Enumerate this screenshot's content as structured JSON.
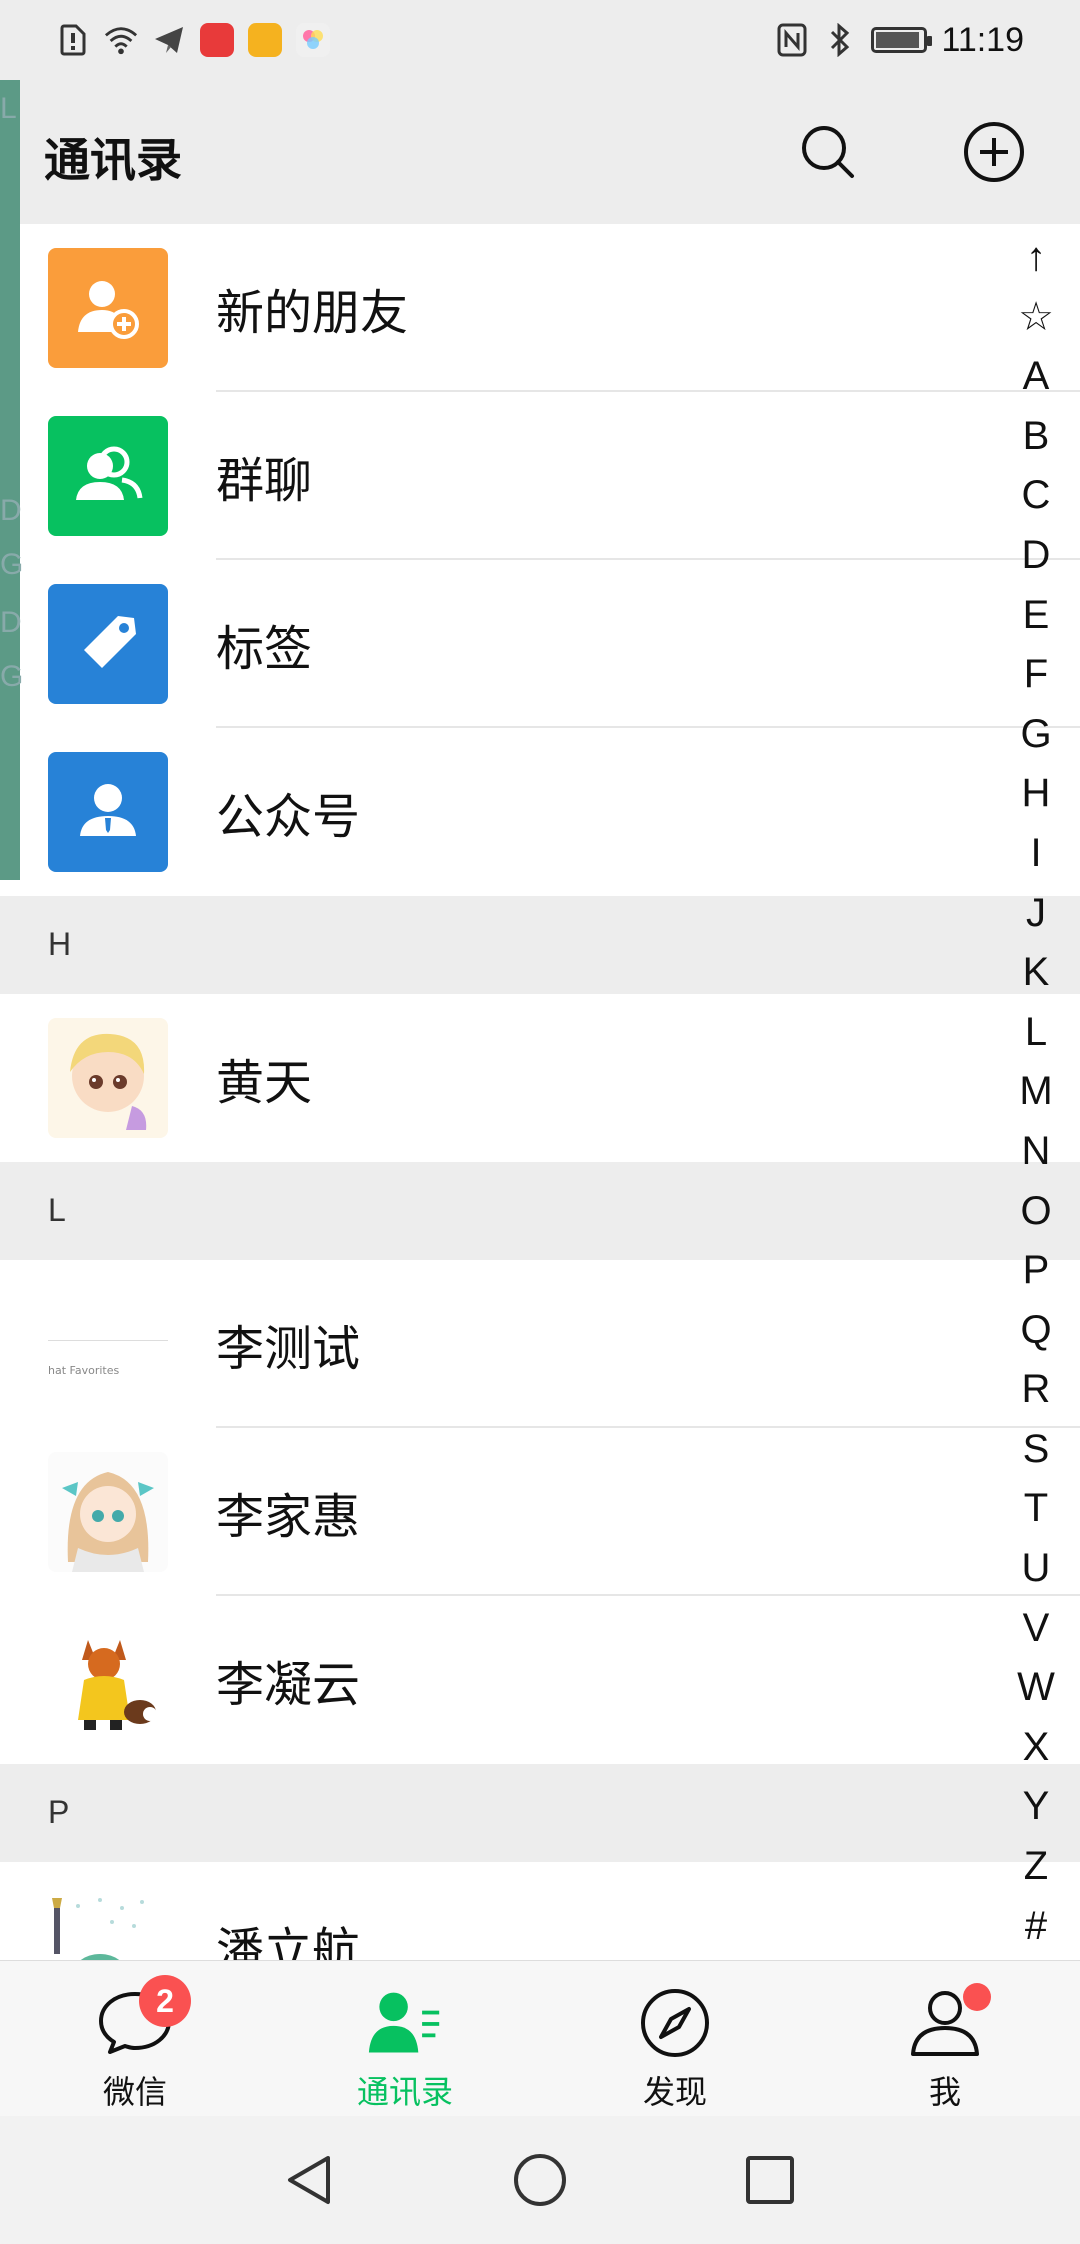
{
  "status_bar": {
    "time": "11:19",
    "left_icons": [
      "alert-icon",
      "wifi-icon",
      "telegram-icon",
      "huawei-store-icon",
      "yellow-app-icon",
      "photos-icon"
    ],
    "right_icons": [
      "nfc-icon",
      "bluetooth-icon",
      "battery-icon"
    ],
    "battery_level": 0.85
  },
  "header": {
    "title": "通讯录",
    "search_icon": "search-icon",
    "add_icon": "plus-circle-icon"
  },
  "functions": [
    {
      "label": "新的朋友",
      "icon": "add-friend-icon",
      "color": "#fa9d3b"
    },
    {
      "label": "群聊",
      "icon": "group-chat-icon",
      "color": "#07c160"
    },
    {
      "label": "标签",
      "icon": "tag-icon",
      "color": "#2782d7"
    },
    {
      "label": "公众号",
      "icon": "official-account-icon",
      "color": "#2782d7"
    }
  ],
  "sections": [
    {
      "letter": "H",
      "contacts": [
        {
          "name": "黄天",
          "avatar": "anime-boy-avatar"
        }
      ]
    },
    {
      "letter": "L",
      "contacts": [
        {
          "name": "李测试",
          "avatar": "screenshot-avatar",
          "avatar_caption": "hat Favorites"
        },
        {
          "name": "李家惠",
          "avatar": "anime-girl-avatar"
        },
        {
          "name": "李凝云",
          "avatar": "fox-avatar"
        }
      ]
    },
    {
      "letter": "P",
      "contacts": [
        {
          "name": "潘立航",
          "avatar": "dinosaur-avatar"
        }
      ]
    }
  ],
  "edge_letters": [
    "L",
    "D",
    "G",
    "D",
    "G"
  ],
  "index": [
    "↑",
    "☆",
    "A",
    "B",
    "C",
    "D",
    "E",
    "F",
    "G",
    "H",
    "I",
    "J",
    "K",
    "L",
    "M",
    "N",
    "O",
    "P",
    "Q",
    "R",
    "S",
    "T",
    "U",
    "V",
    "W",
    "X",
    "Y",
    "Z",
    "#"
  ],
  "tabs": [
    {
      "label": "微信",
      "icon": "chat-bubble-icon",
      "badge": "2"
    },
    {
      "label": "通讯录",
      "icon": "contacts-icon",
      "active": true
    },
    {
      "label": "发现",
      "icon": "compass-icon"
    },
    {
      "label": "我",
      "icon": "person-icon",
      "dot": true
    }
  ],
  "system_nav": [
    "back-icon",
    "home-icon",
    "recents-icon"
  ],
  "colors": {
    "accent": "#07c160",
    "badge": "#fa5151",
    "orange": "#fa9d3b",
    "blue": "#2782d7"
  }
}
